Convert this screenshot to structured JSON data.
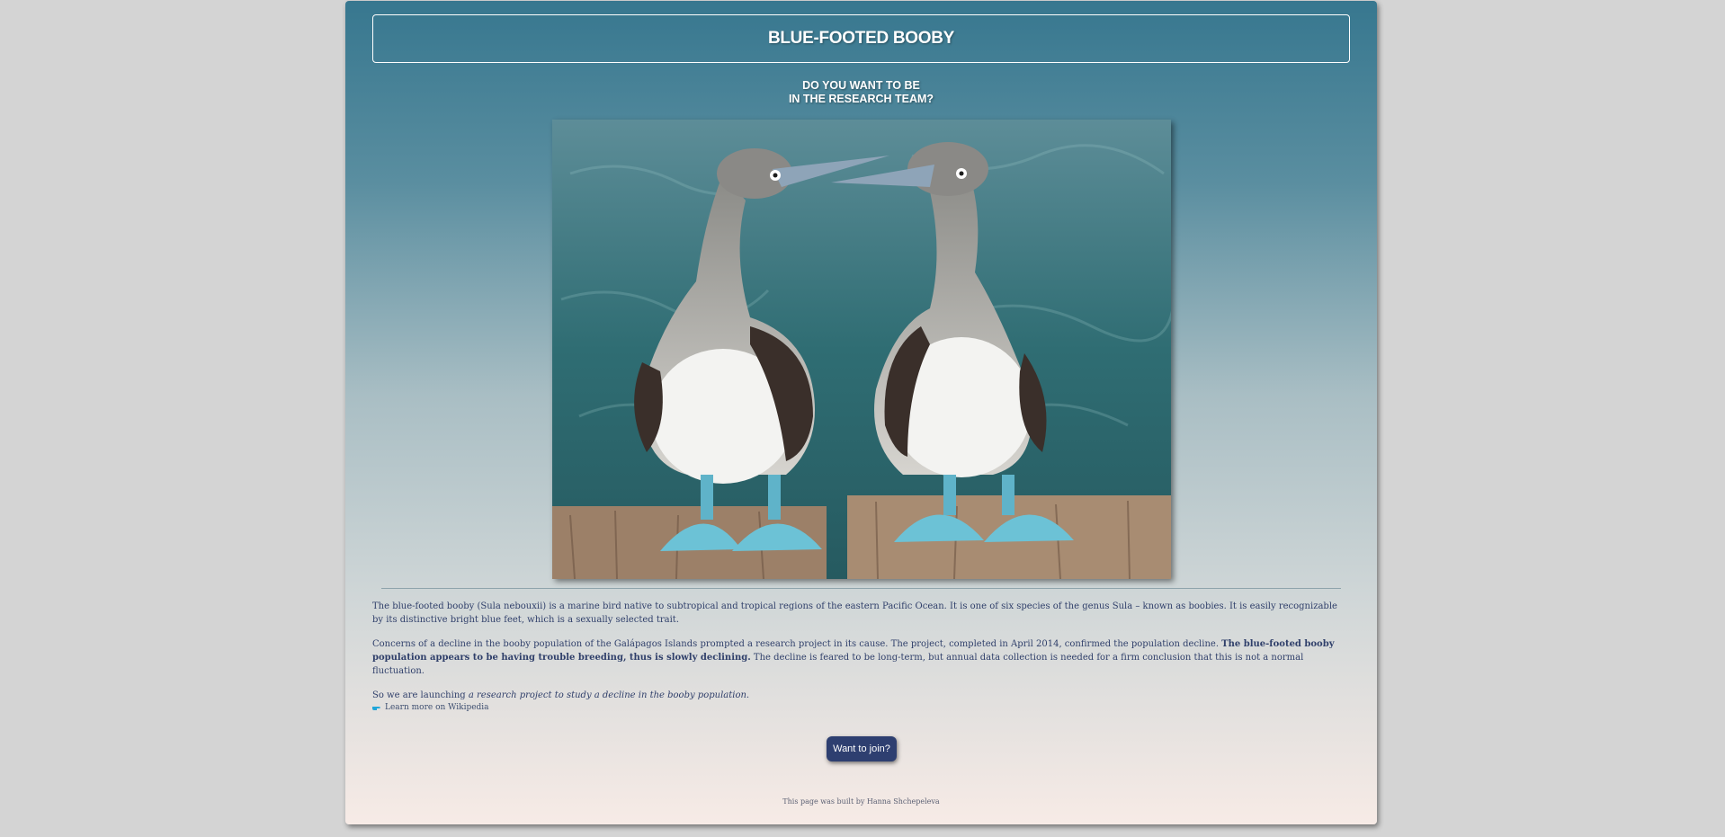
{
  "header": {
    "title": "BLUE-FOOTED BOOBY",
    "subtitle_line1": "DO YOU WANT TO BE",
    "subtitle_line2": "IN THE RESEARCH TEAM?"
  },
  "content": {
    "p1": "The blue-footed booby (Sula nebouxii) is a marine bird native to subtropical and tropical regions of the eastern Pacific Ocean. It is one of six species of the genus Sula – known as boobies. It is easily recognizable by its distinctive bright blue feet, which is a sexually selected trait.",
    "p2_start": "Concerns of a decline in the booby population of the Galápagos Islands prompted a research project in its cause. The project, completed in April 2014, confirmed the population decline. ",
    "p2_bold": "The blue-footed booby population appears to be having trouble breeding, thus is slowly declining.",
    "p2_end": " The decline is feared to be long-term, but annual data collection is needed for a firm conclusion that this is not a normal fluctuation.",
    "p3_start": "So we are launching ",
    "p3_italic": "a research project to study a decline in the booby population",
    "p3_end": ".",
    "wiki_link": "Learn more on Wikipedia"
  },
  "cta": {
    "join_label": "Want to join?"
  },
  "footer": {
    "text": "This page was built by Hanna Shchepeleva"
  },
  "colors": {
    "button": "#2e3f70",
    "text": "#2f3f6a",
    "header_bg": "#37778f",
    "bottom_bg": "#f7ebe6"
  },
  "icons": {
    "wiki_link_icon": "pointing-hand-icon"
  }
}
